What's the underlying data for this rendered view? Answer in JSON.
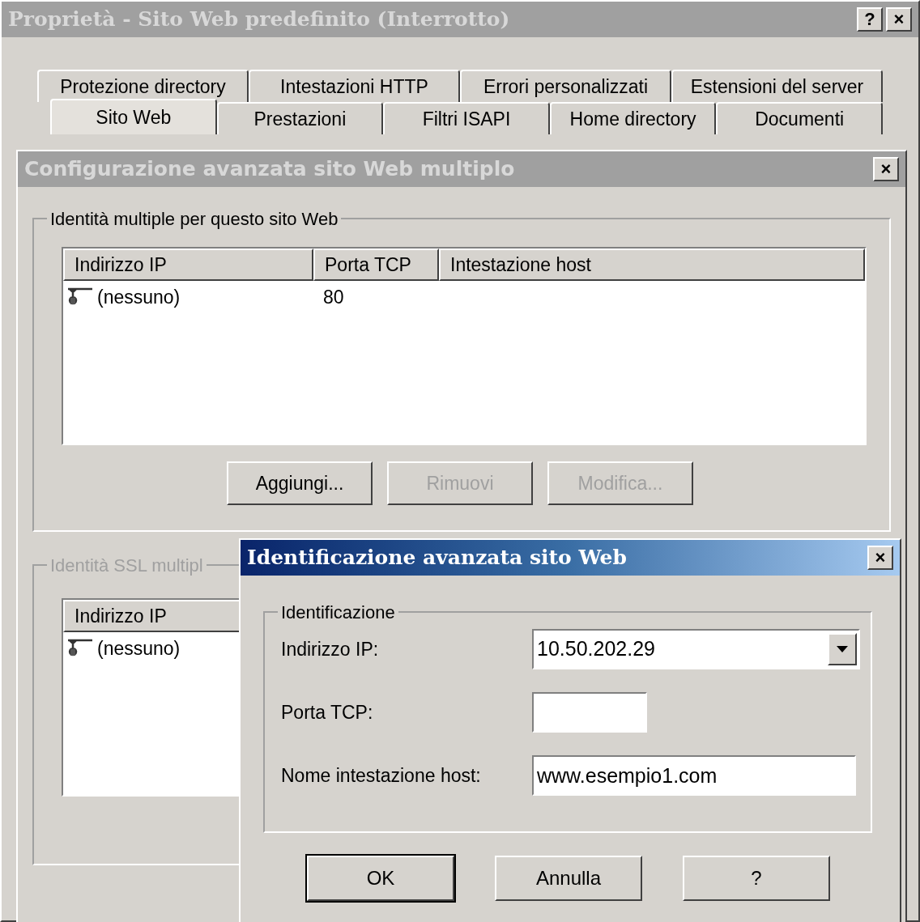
{
  "window": {
    "title": "Proprietà - Sito Web predefinito (Interrotto)",
    "active": false,
    "help": "?",
    "close": "×"
  },
  "tab_rows": [
    [
      {
        "label": "Protezione directory",
        "selected": false
      },
      {
        "label": "Intestazioni HTTP",
        "selected": false
      },
      {
        "label": "Errori personalizzati",
        "selected": false
      },
      {
        "label": "Estensioni del server",
        "selected": false
      }
    ],
    [
      {
        "label": "Sito Web",
        "selected": true
      },
      {
        "label": "Prestazioni",
        "selected": false
      },
      {
        "label": "Filtri ISAPI",
        "selected": false
      },
      {
        "label": "Home directory",
        "selected": false
      },
      {
        "label": "Documenti",
        "selected": false
      }
    ]
  ],
  "multi_site_dialog": {
    "title": "Configurazione avanzata sito Web multiplo",
    "active": false,
    "close": "×",
    "identities": {
      "label": "Identità multiple per questo sito Web",
      "columns": [
        "Indirizzo IP",
        "Porta TCP",
        "Intestazione host"
      ],
      "rows": [
        {
          "ip": "(nessuno)",
          "port": "80"
        }
      ]
    },
    "buttons": [
      {
        "label": "Aggiungi...",
        "disabled": false
      },
      {
        "label": "Rimuovi",
        "disabled": true
      },
      {
        "label": "Modifica...",
        "disabled": true
      }
    ],
    "ssl_identities": {
      "label": "Identità SSL multipl",
      "disabled": true,
      "columns": [
        "Indirizzo IP"
      ],
      "rows": [
        {
          "ip": "(nessuno)"
        }
      ]
    }
  },
  "identification_dialog": {
    "title": "Identificazione avanzata sito Web",
    "active": true,
    "close": "×",
    "group": "Identificazione",
    "fields": [
      {
        "label": "Indirizzo IP:",
        "kind": "combo",
        "value": "10.50.202.29"
      },
      {
        "label": "Porta TCP:",
        "kind": "short"
      },
      {
        "label": "Nome intestazione host:",
        "kind": "text",
        "value": "www.esempio1.com"
      }
    ],
    "buttons": [
      {
        "label": "OK",
        "default": true
      },
      {
        "label": "Annulla",
        "default": false
      },
      {
        "label": "?",
        "default": false
      }
    ]
  }
}
